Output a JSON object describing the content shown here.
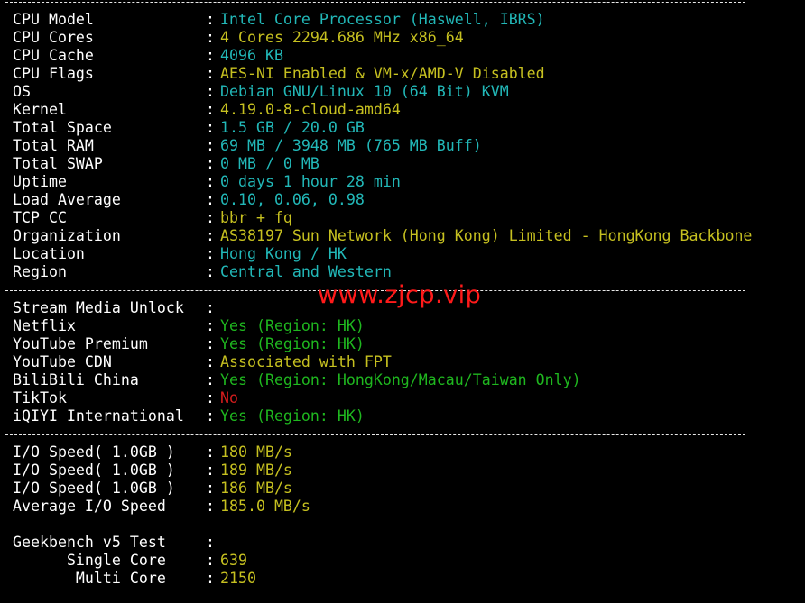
{
  "separator": "----------------------------------------------------------------------------------",
  "colon": ":",
  "system_info": [
    {
      "label": "CPU Model",
      "value": "Intel Core Processor (Haswell, IBRS)",
      "color": "cyan"
    },
    {
      "label": "CPU Cores",
      "value": "4 Cores 2294.686 MHz x86_64",
      "color": "yellow"
    },
    {
      "label": "CPU Cache",
      "value": "4096 KB",
      "color": "cyan"
    },
    {
      "label": "CPU Flags",
      "value": "AES-NI Enabled & VM-x/AMD-V Disabled",
      "color": "yellow"
    },
    {
      "label": "OS",
      "value": "Debian GNU/Linux 10 (64 Bit) KVM",
      "color": "cyan"
    },
    {
      "label": "Kernel",
      "value": "4.19.0-8-cloud-amd64",
      "color": "yellow"
    },
    {
      "label": "Total Space",
      "value": "1.5 GB / 20.0 GB",
      "color": "cyan"
    },
    {
      "label": "Total RAM",
      "value": "69 MB / 3948 MB (765 MB Buff)",
      "color": "cyan"
    },
    {
      "label": "Total SWAP",
      "value": "0 MB / 0 MB",
      "color": "cyan"
    },
    {
      "label": "Uptime",
      "value": "0 days 1 hour 28 min",
      "color": "cyan"
    },
    {
      "label": "Load Average",
      "value": "0.10, 0.06, 0.98",
      "color": "cyan"
    },
    {
      "label": "TCP CC",
      "value": "bbr + fq",
      "color": "yellow"
    },
    {
      "label": "Organization",
      "value": "AS38197 Sun Network (Hong Kong) Limited - HongKong Backbone",
      "color": "yellow"
    },
    {
      "label": "Location",
      "value": "Hong Kong / HK",
      "color": "cyan"
    },
    {
      "label": "Region",
      "value": "Central and Western",
      "color": "cyan"
    }
  ],
  "stream": [
    {
      "label": "Stream Media Unlock",
      "value": "",
      "color": "cyan"
    },
    {
      "label": "Netflix",
      "value": "Yes (Region: HK)",
      "color": "green"
    },
    {
      "label": "YouTube Premium",
      "value": "Yes (Region: HK)",
      "color": "green"
    },
    {
      "label": "YouTube CDN",
      "value": "Associated with FPT",
      "color": "yellow"
    },
    {
      "label": "BiliBili China",
      "value": "Yes (Region: HongKong/Macau/Taiwan Only)",
      "color": "green"
    },
    {
      "label": "TikTok",
      "value": "No",
      "color": "red"
    },
    {
      "label": "iQIYI International",
      "value": "Yes (Region: HK)",
      "color": "green"
    }
  ],
  "io": [
    {
      "label": "I/O Speed( 1.0GB )",
      "value": "180 MB/s",
      "color": "yellow"
    },
    {
      "label": "I/O Speed( 1.0GB )",
      "value": "189 MB/s",
      "color": "yellow"
    },
    {
      "label": "I/O Speed( 1.0GB )",
      "value": "186 MB/s",
      "color": "yellow"
    },
    {
      "label": "Average I/O Speed",
      "value": "185.0 MB/s",
      "color": "yellow"
    }
  ],
  "geekbench": [
    {
      "label": "Geekbench v5 Test",
      "value": "",
      "color": "yellow"
    },
    {
      "label": "      Single Core",
      "value": "639",
      "color": "yellow"
    },
    {
      "label": "       Multi Core",
      "value": "2150",
      "color": "yellow"
    }
  ],
  "watermark": "www.zjcp.vip",
  "colors": {
    "background": "#000000",
    "label": "#ffffff",
    "cyan": "#22b8b8",
    "yellow": "#c6c020",
    "green": "#1fb71f",
    "red": "#d41c1c",
    "watermark": "#ff1a1a"
  }
}
